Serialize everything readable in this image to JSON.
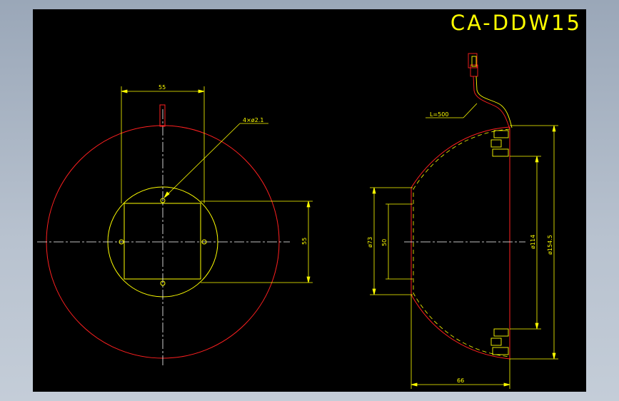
{
  "title": "CA-DDW15",
  "dimensions": {
    "top_width": "55",
    "holes": "4×ø2.1",
    "square_height": "55",
    "cable_length": "L=500",
    "dia_73": "ø73",
    "dim_50": "50",
    "dia_114": "ø114",
    "dia_154": "ø154.5",
    "depth_66": "66"
  },
  "colors": {
    "background": "#000000",
    "outline": "#ff2020",
    "dimension": "#ffff00",
    "centerline": "#ffffff"
  }
}
